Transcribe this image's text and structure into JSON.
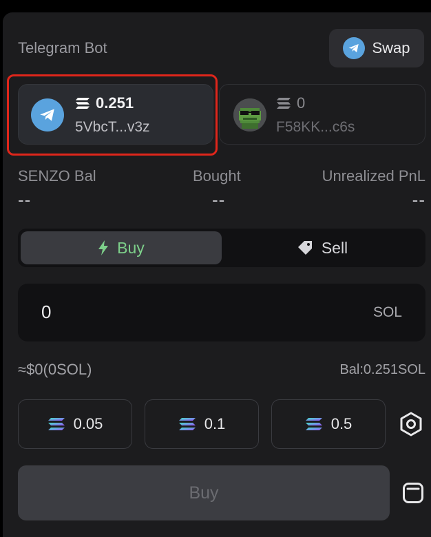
{
  "header": {
    "title": "Telegram Bot",
    "swap_label": "Swap"
  },
  "wallets": [
    {
      "balance": "0.251",
      "address": "5VbcT...v3z",
      "icon": "telegram-icon",
      "selected": true
    },
    {
      "balance": "0",
      "address": "F58KK...c6s",
      "icon": "pixel-frog-avatar",
      "selected": false
    }
  ],
  "stats": [
    {
      "label": "SENZO Bal",
      "value": "--"
    },
    {
      "label": "Bought",
      "value": "--"
    },
    {
      "label": "Unrealized PnL",
      "value": "--"
    }
  ],
  "tabs": {
    "buy": "Buy",
    "sell": "Sell",
    "active": "buy"
  },
  "amount": {
    "value": "0",
    "unit": "SOL"
  },
  "summary": {
    "approx": "≈$0(0SOL)",
    "balance": "Bal:0.251SOL"
  },
  "presets": [
    "0.05",
    "0.1",
    "0.5"
  ],
  "action": {
    "buy_label": "Buy",
    "disabled": true
  },
  "colors": {
    "accent_green": "#7dcf8a",
    "telegram_blue": "#5aa3de",
    "highlight_red": "#e0261b"
  }
}
